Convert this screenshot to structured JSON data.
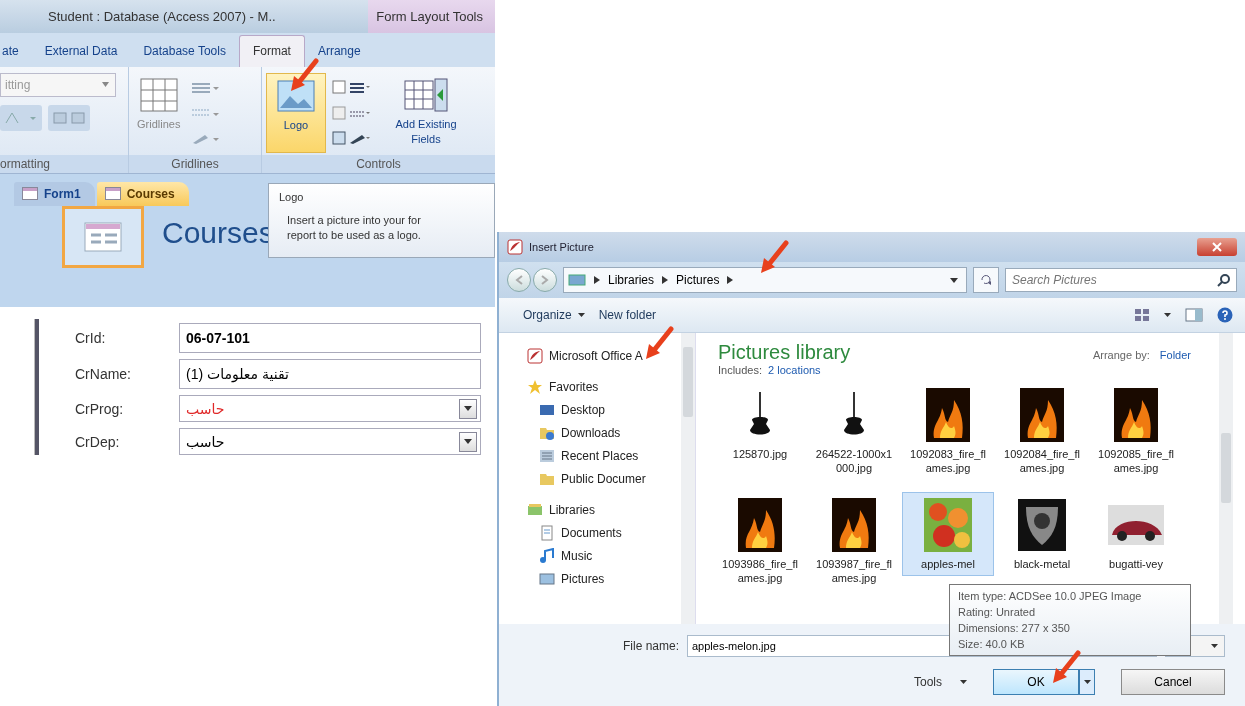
{
  "access_window": {
    "title": "Student : Database (Access 2007) - M..",
    "contextual_title": "Form Layout Tools",
    "ribbon_tabs": [
      {
        "label": "ate",
        "selected": false
      },
      {
        "label": "External Data",
        "selected": false
      },
      {
        "label": "Database Tools",
        "selected": false
      },
      {
        "label": "Format",
        "selected": true
      },
      {
        "label": "Arrange",
        "selected": false
      }
    ],
    "groups": [
      {
        "kind": "formatting",
        "label": "ormatting",
        "dropdown": "itting"
      },
      {
        "kind": "gridlines",
        "label": "Gridlines",
        "button": "Gridlines"
      },
      {
        "kind": "controls",
        "label": "Controls",
        "buttons": [
          {
            "kind": "logo",
            "label": "Logo",
            "highlighted": true
          },
          {
            "kind": "fields",
            "label": "Add Existing Fields",
            "highlighted": false
          }
        ]
      }
    ],
    "doc_tabs": [
      {
        "label": "Form1",
        "selected": false
      },
      {
        "label": "Courses",
        "selected": true
      }
    ],
    "form_title": "Courses",
    "tooltip": {
      "title": "Logo",
      "lines": [
        "Insert a picture into your for",
        "report to be used as a logo."
      ]
    },
    "fields": [
      {
        "label": "CrId:",
        "value": "06-07-101",
        "kind": "text",
        "bold": true,
        "color": "#000000"
      },
      {
        "label": "CrName:",
        "value": "تقنية معلومات (1)",
        "kind": "text",
        "bold": false,
        "color": "#000000"
      },
      {
        "label": "CrProg:",
        "value": "حاسب",
        "kind": "combo",
        "bold": false,
        "color": "#e02828"
      },
      {
        "label": "CrDep:",
        "value": "حاسب",
        "kind": "combo",
        "bold": false,
        "color": "#000000"
      }
    ]
  },
  "dialog": {
    "title": "Insert Picture",
    "breadcrumb": [
      "Libraries",
      "Pictures"
    ],
    "search": {
      "placeholder": "Search Pictures"
    },
    "toolbar": [
      "Organize",
      "New folder"
    ],
    "nav": [
      {
        "label": "Microsoft Office A"
      },
      {
        "label": "Favorites",
        "children": [
          {
            "label": "Desktop"
          },
          {
            "label": "Downloads"
          },
          {
            "label": "Recent Places"
          },
          {
            "label": "Public Documer"
          }
        ]
      },
      {
        "label": "Libraries",
        "children": [
          {
            "label": "Documents"
          },
          {
            "label": "Music"
          },
          {
            "label": "Pictures"
          }
        ]
      }
    ],
    "library_title": "Pictures library",
    "includes_label": "Includes:",
    "includes_link": "2 locations",
    "arrange_label": "Arrange by:",
    "arrange_value": "Folder",
    "files": [
      {
        "name": "125870.jpg",
        "selected": false
      },
      {
        "name": "264522-1000x1000.jpg",
        "selected": false
      },
      {
        "name": "1092083_fire_flames.jpg",
        "selected": false
      },
      {
        "name": "1092084_fire_flames.jpg",
        "selected": false
      },
      {
        "name": "1092085_fire_flames.jpg",
        "selected": false
      },
      {
        "name": "1093986_fire_flames.jpg",
        "selected": false
      },
      {
        "name": "1093987_fire_flames.jpg",
        "selected": false
      },
      {
        "name": "apples-mel",
        "selected": true
      },
      {
        "name": "black-metal",
        "selected": false
      },
      {
        "name": "bugatti-vey",
        "selected": false
      }
    ],
    "item_tooltip": [
      "Item type: ACDSee 10.0 JPEG Image",
      "Rating: Unrated",
      "Dimensions: 277 x 350",
      "Size: 40.0 KB"
    ],
    "file_name_label": "File name:",
    "file_name": "apples-melon.jpg",
    "tools": "Tools",
    "ok": "OK",
    "cancel": "Cancel"
  }
}
